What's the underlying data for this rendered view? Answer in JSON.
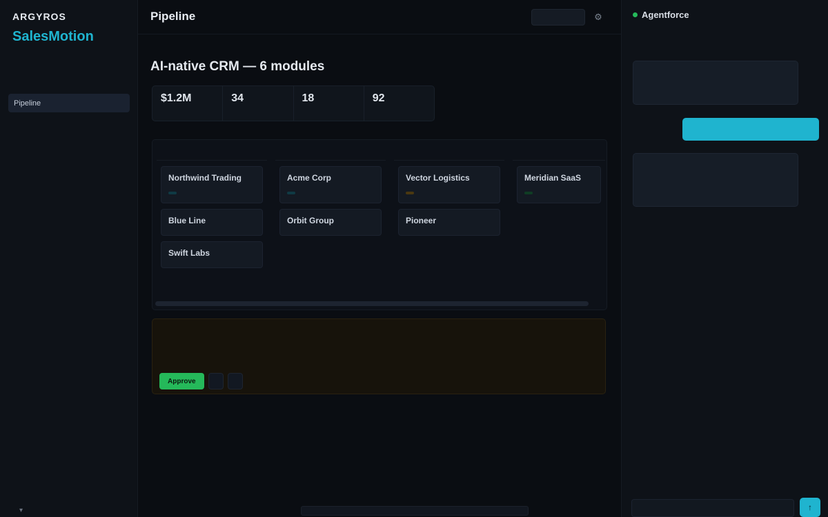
{
  "sidebar": {
    "brand_small": "ARGYROS",
    "brand_main": "SalesMotion",
    "brand_sub": "",
    "section_label": "",
    "items": [
      {
        "label": "Pipeline",
        "badge": ""
      },
      {
        "label": "",
        "badge": ""
      },
      {
        "label": "",
        "badge": ""
      },
      {
        "label": "",
        "badge": ""
      },
      {
        "label": "",
        "badge": ""
      }
    ],
    "footer_label": "",
    "footer_icon": "chevron-down-icon"
  },
  "topbar": {
    "title": "Pipeline",
    "meta": "",
    "button_label": "",
    "icon": "gear-icon"
  },
  "main": {
    "kicker": "",
    "headline": "AI-native CRM — 6 modules",
    "stats": [
      {
        "value": "$1.2M",
        "label": ""
      },
      {
        "value": "34",
        "label": ""
      },
      {
        "value": "18",
        "label": ""
      },
      {
        "value": "92",
        "label": ""
      }
    ],
    "columns": [
      {
        "name": "",
        "count": "",
        "cards": [
          {
            "title": "Northwind Trading",
            "meta": "",
            "tag": "",
            "tag_color": "teal"
          },
          {
            "title": "Blue Line",
            "meta": "",
            "tag": ""
          },
          {
            "title": "Swift Labs",
            "meta": "",
            "tag": ""
          }
        ]
      },
      {
        "name": "",
        "count": "",
        "cards": [
          {
            "title": "Acme Corp",
            "meta": "",
            "tag": "",
            "tag_color": "teal"
          },
          {
            "title": "Orbit Group",
            "meta": "",
            "tag": ""
          }
        ]
      },
      {
        "name": "",
        "count": "",
        "cards": [
          {
            "title": "Vector Logistics",
            "meta": "",
            "tag": "",
            "tag_color": "amber"
          },
          {
            "title": "Pioneer",
            "meta": "",
            "tag": ""
          }
        ]
      },
      {
        "name": "",
        "count": "",
        "cards": [
          {
            "title": "Meridian SaaS",
            "meta": "",
            "tag": "",
            "tag_color": "green"
          }
        ]
      }
    ]
  },
  "alert": {
    "kicker": "",
    "title": "",
    "description": "",
    "approve_label": "Approve",
    "secondary_label": "",
    "tertiary_label": ""
  },
  "statusbar": [
    "",
    "",
    "",
    ""
  ],
  "panel": {
    "title": "Agentforce",
    "subtitle": "",
    "agent_label_1": "",
    "agent_msg_1": "",
    "user_msg": "",
    "agent_label_2": "",
    "agent_msg_2": "",
    "composer_placeholder": "",
    "send_icon": "arrow-up-icon"
  },
  "colors": {
    "accent": "#1fb4cf",
    "success": "#25b95a",
    "warning": "#e0a63a",
    "background": "#0b0e13"
  }
}
